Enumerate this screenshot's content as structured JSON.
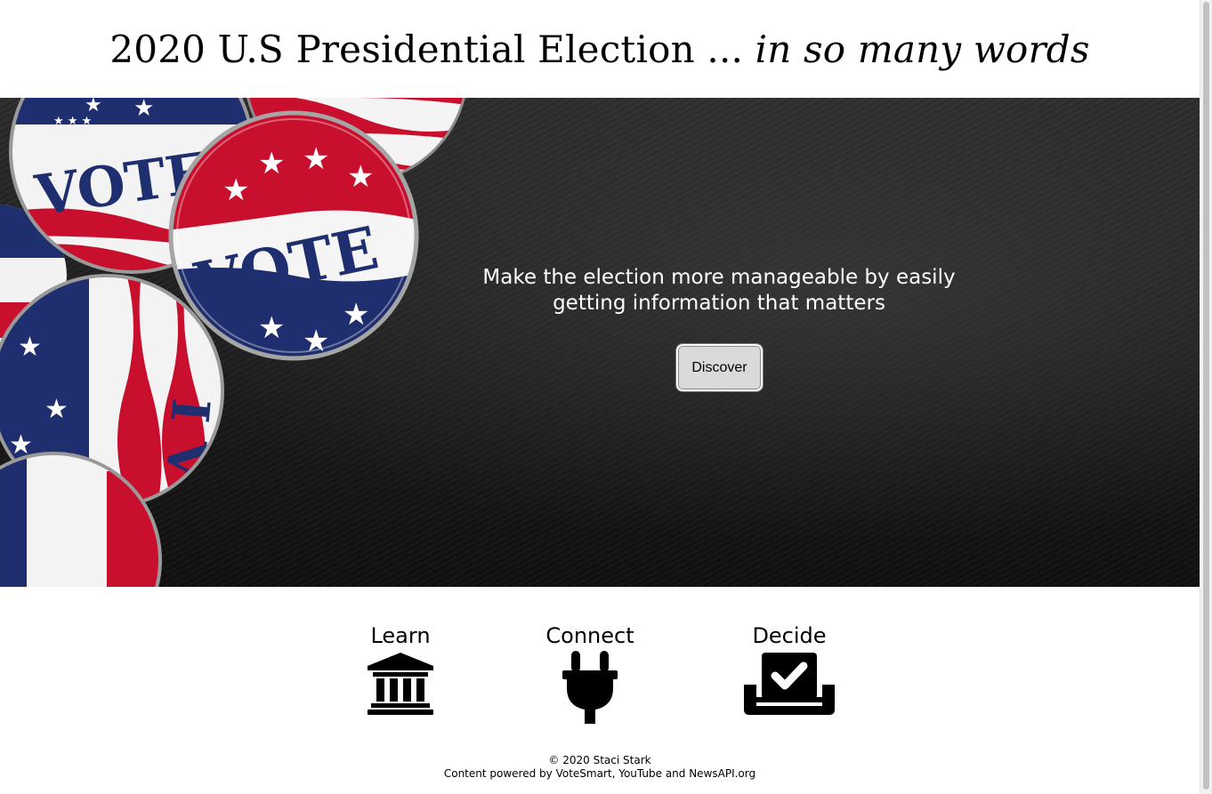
{
  "header": {
    "title_main": "2020 U.S Presidential Election ... ",
    "title_italic": "in so many words"
  },
  "hero": {
    "tagline": "Make the election more manageable by easily getting information that matters",
    "discover_label": "Discover",
    "button_text": {
      "vote": "VOTE",
      "voted": "I VOTED"
    }
  },
  "features": [
    {
      "label": "Learn",
      "icon": "landmark-icon"
    },
    {
      "label": "Connect",
      "icon": "plug-icon"
    },
    {
      "label": "Decide",
      "icon": "vote-box-icon"
    }
  ],
  "footer": {
    "copyright": "© 2020 Staci Stark",
    "credits": "Content powered by VoteSmart, YouTube and NewsAPI.org"
  },
  "colors": {
    "red": "#c8102e",
    "navy": "#1f2e6e",
    "hero_dark": "#1c1c1c"
  }
}
